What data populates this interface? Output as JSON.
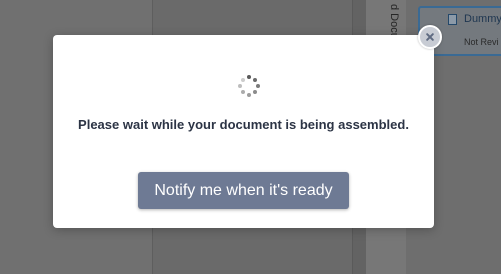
{
  "background": {
    "vertical_tab_label": "d Docu",
    "card": {
      "title": "Dummy",
      "status": "Not Revi"
    }
  },
  "modal": {
    "message": "Please wait while your document is being assembled.",
    "notify_button": "Notify me when it's ready"
  }
}
